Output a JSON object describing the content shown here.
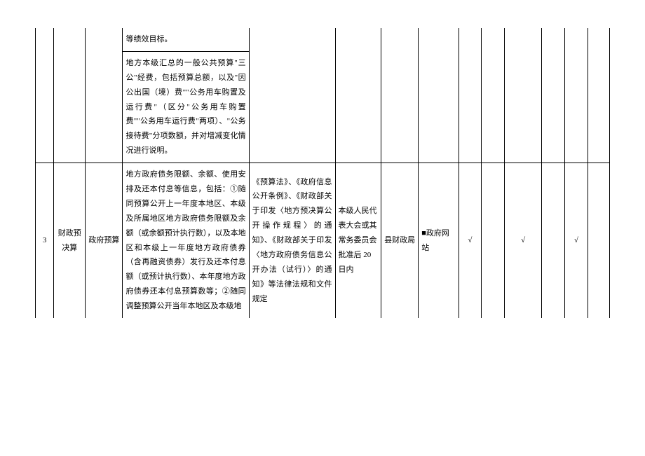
{
  "rows": [
    {
      "content_a": "等绩效目标。",
      "content_b": "地方本级汇总的一般公共预算\"三公\"经费，包括预算总额，以及\"因公出国（境）费\"\"公务用车购置及运行费\"（区分\"公务用车购置费\"\"公务用车运行费\"两项）、\"公务接待费\"分项数额，并对增减变化情况进行说明。"
    },
    {
      "seq": "3",
      "category": "财政预决算",
      "subcategory": "政府预算",
      "content": "地方政府债务限额、余额、使用安排及还本付息等信息，包括：①随同预算公开上一年度本地区、本级及所属地区地方政府债务限额及余额（或余额预计执行数），以及本地区和本级上一年度地方政府债券（含再融资债券）发行及还本付息额（或预计执行数）、本年度地方政府债券还本付息预算数等；②随同调整预算公开当年本地区及本级地",
      "basis": "《预算法》、《政府信息公开条例》、《财政部关于印发〈地方预决算公开操作规程〉的通知》、《财政部关于印发〈地方政府债务信息公开办法（试行）〉的通知》等法律法规和文件规定",
      "timing": "本级人民代表大会或其常务委员会批准后 20 日内",
      "dept": "县财政局",
      "channel": "■政府网站",
      "check1": "√",
      "check2": "",
      "check3": "√",
      "check4": "",
      "check5": "√",
      "check6": ""
    }
  ]
}
